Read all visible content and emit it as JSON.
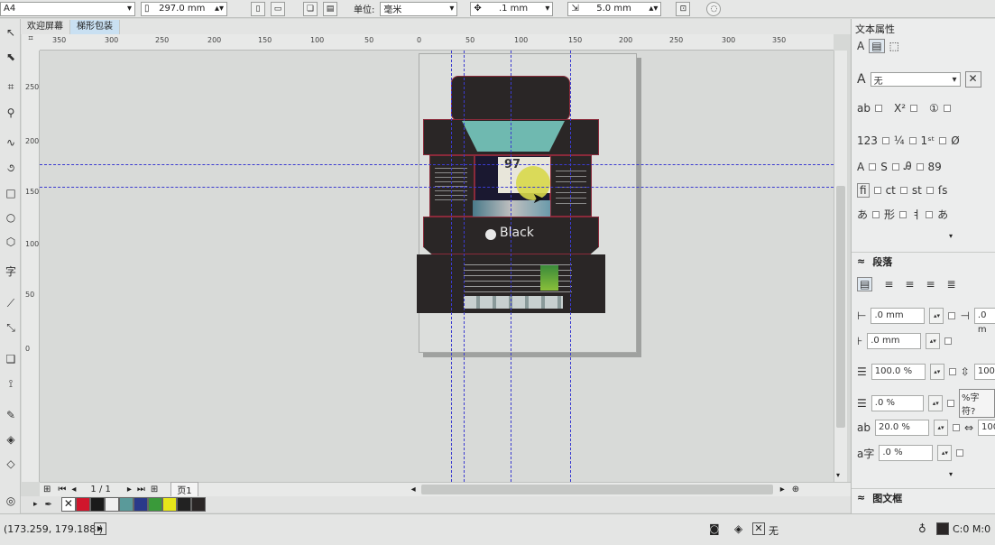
{
  "toolbar": {
    "page_size": "A4",
    "height_value": "297.0 mm",
    "unit_label": "单位:",
    "unit_value": "毫米",
    "nudge_value": ".1 mm",
    "dup_value": "5.0 mm"
  },
  "tabs": [
    {
      "label": "欢迎屏幕"
    },
    {
      "label": "梯形包装"
    }
  ],
  "ruler": {
    "h_ticks": [
      "350",
      "300",
      "250",
      "200",
      "150",
      "100",
      "50",
      "0",
      "50",
      "100",
      "150",
      "200",
      "250",
      "300",
      "350"
    ],
    "v_ticks": [
      "250",
      "200",
      "150",
      "100",
      "50",
      "0"
    ]
  },
  "design": {
    "price_text": "97",
    "brand_text": "Black"
  },
  "page_nav": {
    "current": "1 / 1",
    "page_tab": "页1"
  },
  "palette": {
    "colors": [
      "#d0162c",
      "#1a1a1a",
      "#f0f0f0",
      "#5a9a9a",
      "#2a3a8a",
      "#3a9a3a",
      "#e6e61a",
      "#222222"
    ]
  },
  "status": {
    "coords": "(173.259, 179.188 )",
    "fill_label": "无",
    "color_info": "C:0 M:0"
  },
  "right_panel": {
    "title": "文本属性",
    "font_fill": "无",
    "paragraph_title": "段落",
    "left_indent": ".0 mm",
    "right_indent_partial": ".0 m",
    "first_indent": ".0 mm",
    "line_spacing": "100.0 %",
    "line_spacing2": "100.",
    "before_para": ".0 %",
    "char_pct_btn": "%字符?",
    "char_spacing": "20.0 %",
    "word_spacing": "100.",
    "lang_spacing": ".0 %",
    "frame_title": "图文框"
  }
}
